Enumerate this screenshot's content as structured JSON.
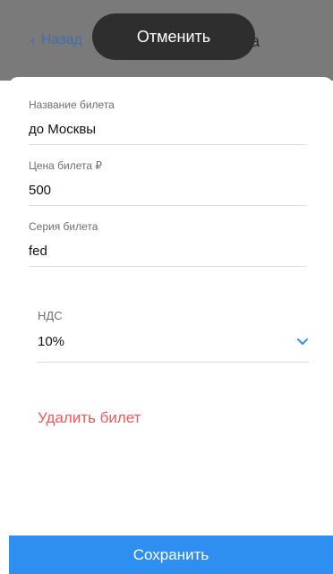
{
  "header": {
    "back_label": "Назад",
    "title_tail": "а"
  },
  "toast": {
    "cancel_label": "Отменить"
  },
  "form": {
    "name": {
      "label": "Название билета",
      "value": "до Москвы"
    },
    "price": {
      "label": "Цена билета ₽",
      "value": "500"
    },
    "series": {
      "label": "Серия билета",
      "value": "fed"
    },
    "vat": {
      "label": "НДС",
      "value": "10%"
    }
  },
  "actions": {
    "delete_label": "Удалить билет",
    "save_label": "Сохранить"
  },
  "colors": {
    "accent": "#2f8ff0",
    "danger": "#ee5a5a",
    "back_link": "#3d6fb0"
  },
  "icons": {
    "back": "chevron-left-icon",
    "dropdown": "chevron-down-icon"
  }
}
